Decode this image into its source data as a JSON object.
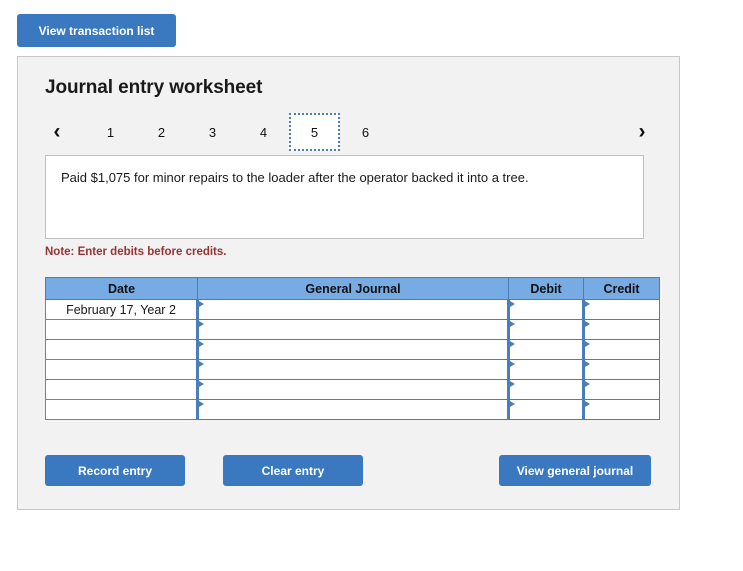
{
  "top_bar": {
    "view_transaction_list_label": "View transaction list"
  },
  "panel": {
    "title": "Journal entry worksheet",
    "pager": {
      "prev_icon": "chevron-left-icon",
      "next_icon": "chevron-right-icon",
      "prev_glyph": "‹",
      "next_glyph": "›",
      "pages": [
        "1",
        "2",
        "3",
        "4",
        "5",
        "6"
      ],
      "active_page": "5"
    },
    "description": "Paid $1,075 for minor repairs to the loader after the operator backed it into a tree.",
    "note": "Note: Enter debits before credits.",
    "table": {
      "headers": [
        "Date",
        "General Journal",
        "Debit",
        "Credit"
      ],
      "rows": [
        {
          "date": "February 17, Year 2",
          "general_journal": "",
          "debit": "",
          "credit": ""
        },
        {
          "date": "",
          "general_journal": "",
          "debit": "",
          "credit": ""
        },
        {
          "date": "",
          "general_journal": "",
          "debit": "",
          "credit": ""
        },
        {
          "date": "",
          "general_journal": "",
          "debit": "",
          "credit": ""
        },
        {
          "date": "",
          "general_journal": "",
          "debit": "",
          "credit": ""
        },
        {
          "date": "",
          "general_journal": "",
          "debit": "",
          "credit": ""
        }
      ]
    },
    "actions": {
      "record_entry_label": "Record entry",
      "clear_entry_label": "Clear entry",
      "view_general_journal_label": "View general journal"
    }
  },
  "colors": {
    "button_blue": "#3a78bf",
    "table_header_blue": "#77abe4",
    "cell_border_blue": "#4a7ebb",
    "panel_bg": "#f2f2f2",
    "note_red": "#993333"
  }
}
